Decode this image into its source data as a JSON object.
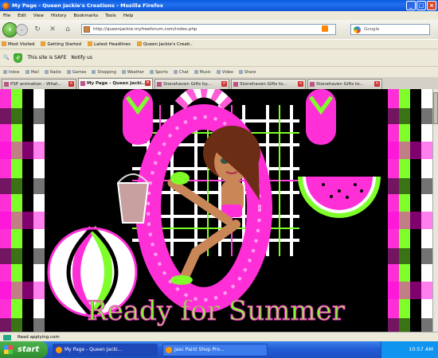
{
  "window": {
    "title": "My Page - Queen Jackie's Creations - Mozilla Firefox"
  },
  "menu": [
    "File",
    "Edit",
    "View",
    "History",
    "Bookmarks",
    "Tools",
    "Help"
  ],
  "nav": {
    "url": "http://queenjackie.myfreeforum.com/index.php",
    "search_placeholder": "Google"
  },
  "bookmarks": [
    "Most Visited",
    "Getting Started",
    "Latest Headlines",
    "Queen Jackie's Creati.."
  ],
  "toolbar1": {
    "safe_label": "This site is SAFE",
    "notify_label": "Notify us"
  },
  "toolbar2": [
    "Inbox",
    "Mail",
    "Radio",
    "Games",
    "Shopping",
    "Weather",
    "Sports",
    "Chat",
    "Music",
    "Video",
    "Share"
  ],
  "tabs": [
    {
      "label": "PSP animation - What..."
    },
    {
      "label": "My Page - Queen Jacki...",
      "active": true
    },
    {
      "label": "Stonehaven Gifts by..."
    },
    {
      "label": "Stonehaven Gifts to..."
    },
    {
      "label": "Stonehaven Gifts to..."
    }
  ],
  "content": {
    "heading": "Ready for Summer"
  },
  "status": "Read applying.com",
  "taskbar": {
    "start": "start",
    "items": [
      "My Page - Queen Jacki...",
      "Jasc Paint Shop Pro..."
    ],
    "clock": "10:57 AM"
  },
  "colors": {
    "pink": "#ff2fd7",
    "lime": "#7fff2a",
    "black": "#000000"
  }
}
